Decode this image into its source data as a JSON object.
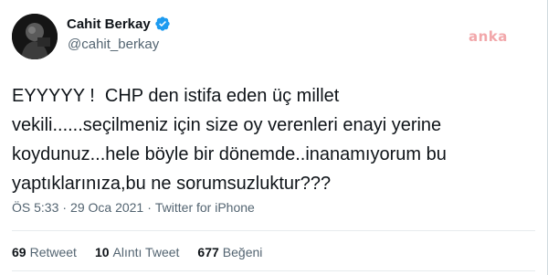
{
  "author": {
    "display_name": "Cahit Berkay",
    "handle": "@cahit_berkay",
    "verified": true,
    "verified_color": "#1d9bf0"
  },
  "watermark": {
    "text": "anka"
  },
  "tweet": {
    "text": "EYYYYY !  CHP den istifa eden üç millet\nvekili......seçilmeniz için size oy verenleri enayi yerine\nkoydunuz...hele böyle bir dönemde..inanamıyorum bu\nyaptıklarınıza,bu ne sorumsuzluktur???",
    "time": "ÖS 5:33",
    "separator": "·",
    "date": "29 Oca 2021",
    "separator2": "·",
    "app": "Twitter for iPhone"
  },
  "stats": {
    "retweets_count": "69",
    "retweets_label": "Retweet",
    "quotes_count": "10",
    "quotes_label": "Alıntı Tweet",
    "likes_count": "677",
    "likes_label": "Beğeni"
  }
}
